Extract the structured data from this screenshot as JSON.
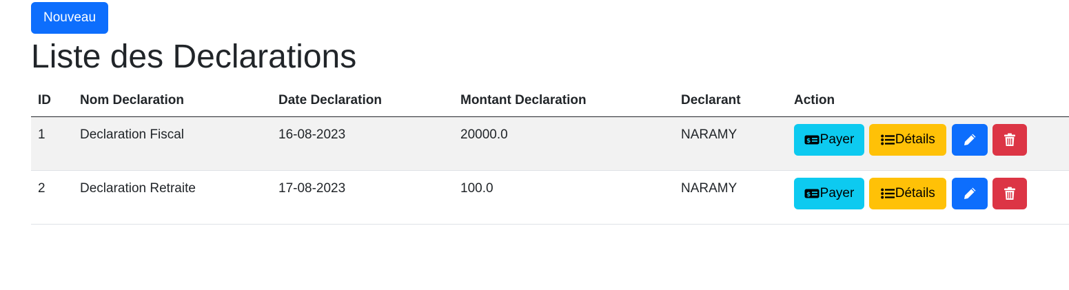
{
  "toolbar": {
    "new_label": "Nouveau"
  },
  "page": {
    "title": "Liste des Declarations"
  },
  "table": {
    "columns": [
      "ID",
      "Nom Declaration",
      "Date Declaration",
      "Montant Declaration",
      "Declarant",
      "Action"
    ],
    "rows": [
      {
        "id": "1",
        "nom": "Declaration Fiscal",
        "date": "16-08-2023",
        "montant": "20000.0",
        "declarant": "NARAMY"
      },
      {
        "id": "2",
        "nom": "Declaration Retraite",
        "date": "17-08-2023",
        "montant": "100.0",
        "declarant": "NARAMY"
      }
    ]
  },
  "actions": {
    "pay_label": "Payer",
    "details_label": "Détails",
    "pay_icon": "cash-icon",
    "details_icon": "list-icon",
    "edit_icon": "pencil-icon",
    "delete_icon": "trash-icon"
  },
  "colors": {
    "primary": "#0d6efd",
    "info": "#0dcaf0",
    "warning": "#ffc107",
    "danger": "#dc3545",
    "striped_row": "#f2f2f2"
  }
}
